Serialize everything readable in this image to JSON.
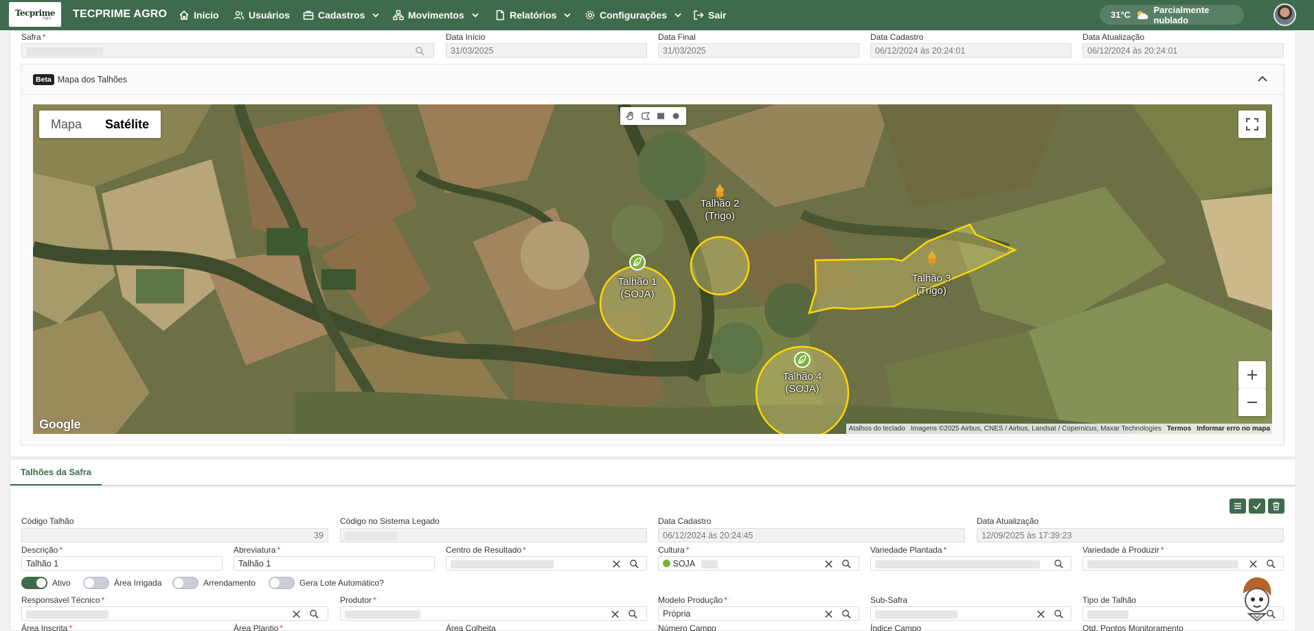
{
  "nav": {
    "logo_text": "Tecprime",
    "logo_sub": "Agro",
    "brand": "TECPRIME AGRO",
    "items": [
      {
        "label": "Início",
        "icon": "home-icon",
        "dropdown": false
      },
      {
        "label": "Usuários",
        "icon": "users-icon",
        "dropdown": false
      },
      {
        "label": "Cadastros",
        "icon": "briefcase-icon",
        "dropdown": true
      },
      {
        "label": "Movimentos",
        "icon": "network-icon",
        "dropdown": true
      },
      {
        "label": "Relatórios",
        "icon": "document-icon",
        "dropdown": true
      },
      {
        "label": "Configurações",
        "icon": "gear-icon",
        "dropdown": true
      },
      {
        "label": "Sair",
        "icon": "logout-icon",
        "dropdown": false
      }
    ],
    "weather": {
      "temp": "31°C",
      "condition": "Parcialmente nublado",
      "icon": "partly-cloudy-icon"
    }
  },
  "safra": {
    "safra_label": "Safra",
    "data_inicio_label": "Data Início",
    "data_inicio": "31/03/2025",
    "data_final_label": "Data Final",
    "data_final": "31/03/2025",
    "data_cadastro_label": "Data Cadastro",
    "data_cadastro": "06/12/2024 às 20:24:01",
    "data_atualizacao_label": "Data Atualização",
    "data_atualizacao": "06/12/2024 às 20:24:01"
  },
  "map_panel": {
    "badge": "Beta",
    "title": "Mapa dos Talhões",
    "map_type_options": [
      "Mapa",
      "Satélite"
    ],
    "selected_map_type": "Satélite",
    "google_text": "Google",
    "attribution": {
      "shortcuts": "Atalhos do teclado",
      "imagery": "Imagens ©2025 Airbus, CNES / Airbus, Landsat / Copernicus, Maxar Technologies",
      "terms": "Termos",
      "report": "Informar erro no mapa"
    },
    "fields": [
      {
        "name": "Talhão 1",
        "crop": "(SOJA)",
        "crop_icon": "leaf-icon"
      },
      {
        "name": "Talhão 2",
        "crop": "(Trigo)",
        "crop_icon": "wheat-icon"
      },
      {
        "name": "Talhão 3",
        "crop": "(Trigo)",
        "crop_icon": "wheat-icon"
      },
      {
        "name": "Talhão 4",
        "crop": "(SOJA)",
        "crop_icon": "leaf-icon"
      }
    ]
  },
  "talhoes": {
    "tab": "Talhões da Safra",
    "codigo_label": "Código Talhão",
    "codigo": "39",
    "codigo_legado_label": "Código no Sistema Legado",
    "data_cadastro_label": "Data Cadastro",
    "data_cadastro": "06/12/2024 às 20:24:45",
    "data_atualizacao_label": "Data Atualização",
    "data_atualizacao": "12/09/2025 às 17:39:23",
    "descricao_label": "Descrição",
    "descricao": "Talhão 1",
    "abreviatura_label": "Abreviatura",
    "abreviatura": "Talhão 1",
    "centro_label": "Centro de Resultado",
    "cultura_label": "Cultura",
    "cultura": "SOJA",
    "variedade_plantada_label": "Variedade Plantada",
    "variedade_produzir_label": "Variedade à Produzir",
    "toggles": [
      {
        "label": "Ativo",
        "on": true
      },
      {
        "label": "Área Irrigada",
        "on": false
      },
      {
        "label": "Arrendamento",
        "on": false
      },
      {
        "label": "Gera Lote Automático?",
        "on": false
      }
    ],
    "responsavel_label": "Responsável Técnico",
    "produtor_label": "Produtor",
    "modelo_label": "Modelo Produção",
    "modelo": "Própria",
    "subsafra_label": "Sub-Safra",
    "tipo_label": "Tipo de Talhão",
    "area_inscrita_label": "Área Inscrita",
    "area_plantio_label": "Área Plantio",
    "area_colheita_label": "Área Colheita",
    "numero_campo_label": "Número Campo",
    "indice_campo_label": "Índice Campo",
    "qtd_pontos_label": "Qtd. Pontos Monitoramento"
  }
}
